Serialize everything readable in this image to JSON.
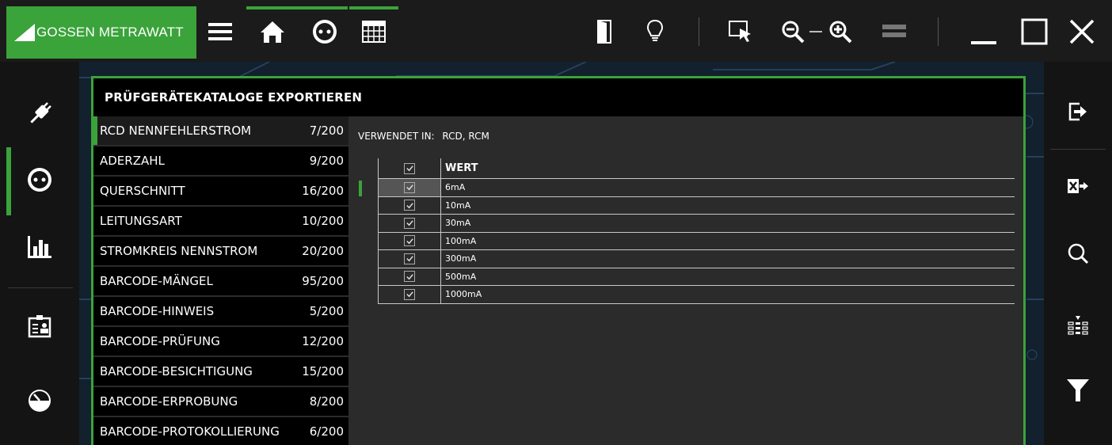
{
  "app": {
    "logo_text": "GOSSEN METRAWATT"
  },
  "colors": {
    "accent": "#3aa33a",
    "panel": "#2b2b2b",
    "bar": "#141414"
  },
  "toolbar": {
    "left_icons": [
      "menu-icon",
      "home-icon",
      "socket-icon",
      "table-icon"
    ],
    "right_icons": [
      "door-icon",
      "lightbulb-icon",
      "select-cursor-icon",
      "zoom-out-icon",
      "zoom-in-icon",
      "layout-icon",
      "minimize-icon",
      "maximize-icon",
      "close-icon"
    ]
  },
  "left_sidebar": {
    "items": [
      "plug-icon",
      "socket-icon",
      "chart-icon",
      "id-card-icon",
      "gauge-icon"
    ],
    "active_index": 1
  },
  "right_sidebar": {
    "items": [
      "export-icon",
      "excel-export-icon",
      "search-icon",
      "sort-icon",
      "filter-icon"
    ]
  },
  "dialog": {
    "title": "PRÜFGERÄTEKATALOGE EXPORTIEREN",
    "categories": [
      {
        "name": "RCD NENNFEHLERSTROM",
        "count": "7/200"
      },
      {
        "name": "ADERZAHL",
        "count": "9/200"
      },
      {
        "name": "QUERSCHNITT",
        "count": "16/200"
      },
      {
        "name": "LEITUNGSART",
        "count": "10/200"
      },
      {
        "name": "STROMKREIS NENNSTROM",
        "count": "20/200"
      },
      {
        "name": "BARCODE-MÄNGEL",
        "count": "95/200"
      },
      {
        "name": "BARCODE-HINWEIS",
        "count": "5/200"
      },
      {
        "name": "BARCODE-PRÜFUNG",
        "count": "12/200"
      },
      {
        "name": "BARCODE-BESICHTIGUNG",
        "count": "15/200"
      },
      {
        "name": "BARCODE-ERPROBUNG",
        "count": "8/200"
      },
      {
        "name": "BARCODE-PROTOKOLLIERUNG",
        "count": "6/200"
      }
    ],
    "selected_category": 0,
    "used_in_label": "VERWENDET IN:",
    "used_in_value": "RCD, RCM",
    "table": {
      "header": "WERT",
      "header_checked": true,
      "rows": [
        {
          "value": "6mA",
          "checked": true
        },
        {
          "value": "10mA",
          "checked": true
        },
        {
          "value": "30mA",
          "checked": true
        },
        {
          "value": "100mA",
          "checked": true
        },
        {
          "value": "300mA",
          "checked": true
        },
        {
          "value": "500mA",
          "checked": true
        },
        {
          "value": "1000mA",
          "checked": true
        }
      ],
      "selected_row": 0
    }
  }
}
